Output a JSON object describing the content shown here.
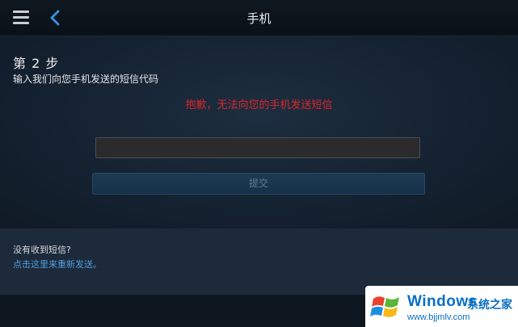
{
  "header": {
    "title": "手机",
    "menu_icon": "hamburger-menu-icon",
    "back_icon": "chevron-left-icon"
  },
  "main": {
    "step_title": "第 2 步",
    "step_subtitle": "输入我们向您手机发送的短信代码",
    "error_message": "抱歉，无法向您的手机发送短信",
    "code_input": {
      "value": "",
      "placeholder": ""
    },
    "submit_label": "提交"
  },
  "footer": {
    "no_sms_text": "没有收到短信?",
    "resend_link": "点击这里来重新发送。"
  },
  "watermark": {
    "brand": "Windows",
    "brand_cn": "系统之家",
    "url": "www.bjjmlv.com"
  },
  "colors": {
    "error": "#d8262a",
    "link": "#4d9fe0",
    "watermark_blue": "#0a6fc4"
  }
}
